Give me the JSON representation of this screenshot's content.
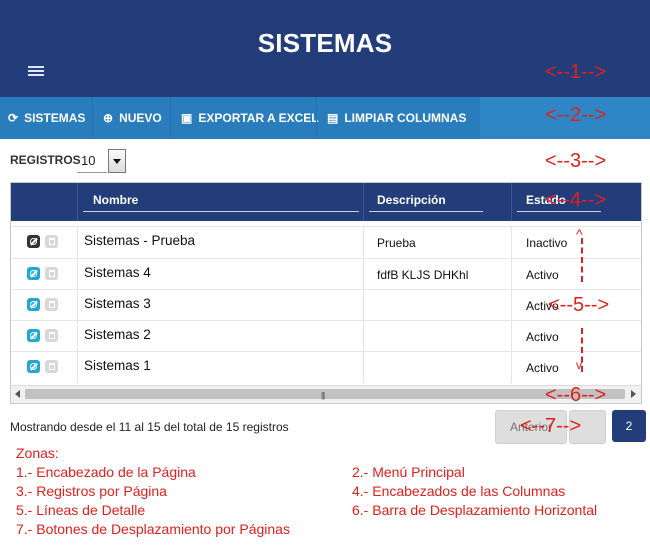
{
  "header": {
    "title": "SISTEMAS"
  },
  "menu": {
    "items": [
      {
        "label": "SISTEMAS",
        "icon": "refresh-icon"
      },
      {
        "label": "NUEVO",
        "icon": "plus-circle-icon"
      },
      {
        "label": "EXPORTAR A EXCEL",
        "icon": "excel-file-icon"
      },
      {
        "label": "LIMPIAR COLUMNAS",
        "icon": "document-icon"
      }
    ]
  },
  "records": {
    "label": "REGISTROS",
    "value": "10"
  },
  "table": {
    "columns": [
      "Nombre",
      "Descripción",
      "Estado"
    ],
    "rows": [
      {
        "name": "Sistemas     - Prueba",
        "description": "Prueba",
        "status": "Inactivo"
      },
      {
        "name": "Sistemas  4",
        "description": "fdfB KLJS DHKhl",
        "status": "Activo"
      },
      {
        "name": "Sistemas  3",
        "description": "",
        "status": "Activo"
      },
      {
        "name": "Sistemas  2",
        "description": "",
        "status": "Activo"
      },
      {
        "name": "Sistemas  1",
        "description": "",
        "status": "Activo"
      }
    ]
  },
  "footer": {
    "info": "Mostrando desde el 11 al 15 del total de 15 registros",
    "prev_label": "Anterior",
    "current_page": "2"
  },
  "annotations": {
    "a1": "<--1-->",
    "a2": "<--2-->",
    "a3": "<--3-->",
    "a4": "<--4-->",
    "a5": "<--5-->",
    "a6": "<--6-->",
    "a7": "<--7-->"
  },
  "legend": {
    "title": "Zonas:",
    "items": [
      "1.- Encabezado de la Página",
      "2.- Menú Principal",
      "3.- Registros por Página",
      "4.- Encabezados de las Columnas",
      "5.- Líneas de Detalle",
      "6.- Barra de Desplazamiento Horizontal",
      "7.- Botones de Desplazamiento por Páginas"
    ]
  },
  "colors": {
    "header": "#233d7b",
    "menu": "#2f86c6",
    "accent_action": "#1fa7d6",
    "annotation": "#e0201c"
  }
}
